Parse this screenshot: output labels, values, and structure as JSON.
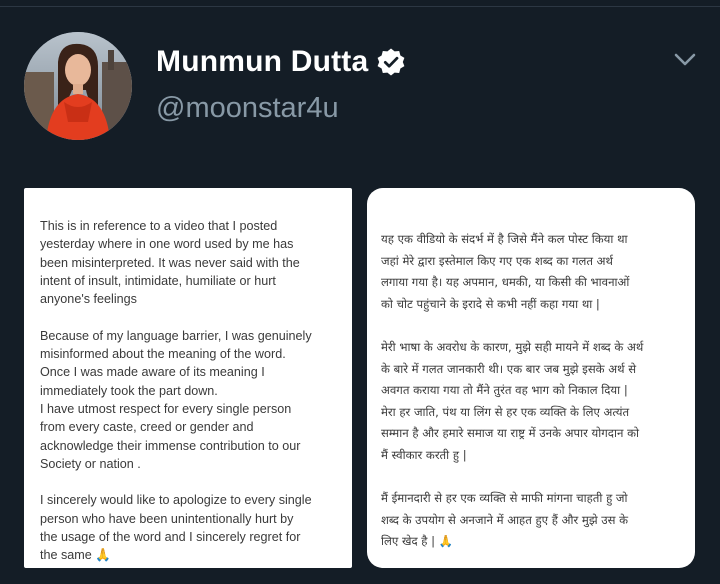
{
  "profile": {
    "display_name": "Munmun Dutta",
    "handle": "@moonstar4u",
    "verified_icon": "verified-badge-icon",
    "menu_icon": "chevron-down-icon"
  },
  "colors": {
    "background": "#141d26",
    "name": "#ffffff",
    "handle": "#8899a6",
    "card": "#ffffff",
    "card_text": "#3a3a3a"
  },
  "card_english": {
    "paragraphs": [
      [
        "This is in reference to a video that I posted",
        "yesterday  where in one word used by me has",
        "been misinterpreted.   It was never said with the",
        "intent of insult, intimidate, humiliate or hurt",
        "anyone's feelings"
      ],
      [
        "Because of my language barrier,  I was genuinely",
        "misinformed about the meaning of the word.",
        "Once I was made aware of its  meaning I",
        "immediately took the part down.",
        "I have utmost respect for every single person",
        "from every caste, creed or gender and",
        "acknowledge their immense contribution to our",
        "Society or nation ."
      ],
      [
        "I sincerely would like to apologize to every single",
        "person  who have been unintentionally hurt by",
        "the usage of the word and I sincerely regret for",
        "the same  🙏"
      ]
    ]
  },
  "card_hindi": {
    "paragraphs": [
      [
        "यह एक वीडियो के संदर्भ में है जिसे मैंने कल पोस्ट किया था",
        "जहां मेरे द्वारा इस्तेमाल किए गए एक शब्द का गलत अर्थ",
        "लगाया गया है। यह अपमान, धमकी, या किसी की भावनाओं",
        "को चोट पहुंचाने के इरादे से कभी नहीं कहा गया था |"
      ],
      [
        "मेरी भाषा के अवरोध के कारण, मुझे सही मायने में शब्द के अर्थ",
        "के बारे में गलत जानकारी थी। एक बार जब मुझे इसके अर्थ से",
        "अवगत कराया गया तो मैंने तुरंत वह भाग को निकाल दिया |",
        "मेरा हर जाति, पंथ या लिंग से हर एक व्यक्ति के लिए अत्यंत",
        "सम्मान है और हमारे समाज या राष्ट्र में उनके अपार योगदान को",
        "मैं स्वीकार करती हु |"
      ],
      [
        "मैं ईमानदारी से हर एक व्यक्ति से माफी मांगना चाहती हु जो",
        "शब्द के उपयोग से अनजाने में आहत हुए हैं और मुझे उस के",
        "लिए खेद है | 🙏"
      ]
    ]
  }
}
